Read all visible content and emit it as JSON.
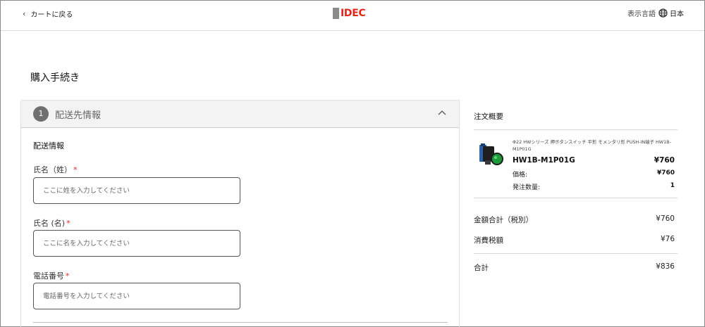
{
  "header": {
    "back_label": "カートに戻る",
    "logo_text": "IDEC",
    "language_label": "表示言語",
    "language_value": "日本"
  },
  "page": {
    "title": "購入手続き"
  },
  "step": {
    "number": "1",
    "title": "配送先情報",
    "section_label": "配送情報",
    "fields": {
      "last_name": {
        "label": "氏名（姓）",
        "required_mark": "*",
        "placeholder": "ここに姓を入力してください",
        "value": ""
      },
      "first_name": {
        "label": "氏名 (名)",
        "required_mark": "*",
        "placeholder": "ここに名を入力してください",
        "value": ""
      },
      "phone": {
        "label": "電話番号",
        "required_mark": "*",
        "placeholder": "電話番号を入力してください",
        "value": ""
      }
    }
  },
  "summary": {
    "title": "注文概要",
    "item": {
      "description": "Φ22 HWシリーズ 押ボタンスイッチ 平形 モメンタリ形 PUSH-IN端子 HW1B-M1P01G",
      "model": "HW1B-M1P01G",
      "line_total": "¥760",
      "price_label": "価格:",
      "price_value": "¥760",
      "qty_label": "発注数量:",
      "qty_value": "1"
    },
    "subtotal_label": "金額合計（税別）",
    "subtotal_value": "¥760",
    "tax_label": "消費税額",
    "tax_value": "¥76",
    "total_label": "合計",
    "total_value": "¥836"
  },
  "colors": {
    "brand_red": "#e1251b",
    "step_bg": "#f3f3f3",
    "step_number_bg": "#6f6f6f"
  },
  "icons": {
    "back": "chevron-left-icon",
    "language": "globe-icon",
    "collapse": "chevron-up-icon"
  }
}
